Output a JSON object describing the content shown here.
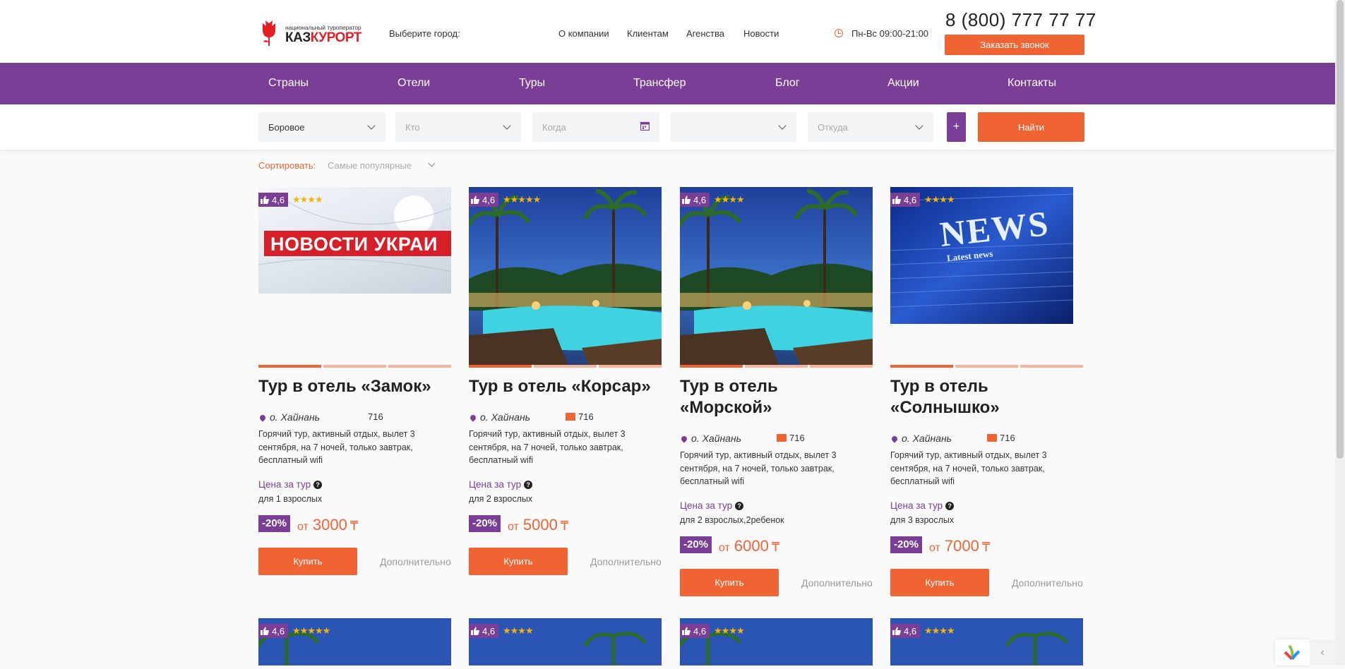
{
  "header": {
    "logo": {
      "subtitle": "национальный туроператор",
      "brand_part1": "КАЗ",
      "brand_part2": "КУРОРТ"
    },
    "city_label": "Выберите город:",
    "nav": [
      "О компании",
      "Клиентам",
      "Агенства",
      "Новости"
    ],
    "hours": "Пн-Вс 09:00-21:00",
    "phone": "8 (800) 777 77 77",
    "callback_button": "Заказать звонок"
  },
  "main_nav": [
    "Страны",
    "Отели",
    "Туры",
    "Трансфер",
    "Блог",
    "Акции",
    "Контакты"
  ],
  "search": {
    "destination": "Боровое",
    "who_placeholder": "Кто",
    "when_placeholder": "Когда",
    "empty_select": "",
    "from_placeholder": "Откуда",
    "plus_button": "+",
    "find_button": "Найти"
  },
  "sort": {
    "label": "Сортировать:",
    "value": "Самые популярные"
  },
  "cards": [
    {
      "rating": "4,6",
      "stars": "★★★★",
      "title": "Тур в отель «Замок»",
      "location": "о. Хайнань",
      "reviews": "716",
      "description": "Горячий тур, активный отдых, вылет 3 сентября, на 7 ночей, только завтрак, бесплатный wifi",
      "price_label": "Цена за тур",
      "guests": "для 1 взрослых",
      "discount": "-20%",
      "price_from": "от",
      "price": "3000",
      "currency": "₸",
      "buy": "Купить",
      "more": "Дополнительно",
      "image": "news-ukraine",
      "image_text": "НОВОСТИ УКРАИ"
    },
    {
      "rating": "4,6",
      "stars": "★★★★★",
      "title": "Тур в отель «Корсар»",
      "location": "о. Хайнань",
      "reviews": "716",
      "description": "Горячий тур, активный отдых, вылет 3 сентября, на 7 ночей, только завтрак, бесплатный wifi",
      "price_label": "Цена за тур",
      "guests": "для 2 взрослых",
      "discount": "-20%",
      "price_from": "от",
      "price": "5000",
      "currency": "₸",
      "buy": "Купить",
      "more": "Дополнительно",
      "image": "resort-pool"
    },
    {
      "rating": "4,6",
      "stars": "★★★★",
      "title": "Тур в отель «Морской»",
      "location": "о. Хайнань",
      "reviews": "716",
      "description": "Горячий тур, активный отдых, вылет 3 сентября, на 7 ночей, только завтрак, бесплатный wifi",
      "price_label": "Цена за тур",
      "guests": "для 2 взрослых,2ребенок",
      "discount": "-20%",
      "price_from": "от",
      "price": "6000",
      "currency": "₸",
      "buy": "Купить",
      "more": "Дополнительно",
      "image": "resort-pool"
    },
    {
      "rating": "4,6",
      "stars": "★★★★",
      "title": "Тур в отель «Солнышко»",
      "location": "о. Хайнань",
      "reviews": "716",
      "description": "Горячий тур, активный отдых, вылет 3 сентября, на 7 ночей, только завтрак, бесплатный wifi",
      "price_label": "Цена за тур",
      "guests": "для 3 взрослых",
      "discount": "-20%",
      "price_from": "от",
      "price": "7000",
      "currency": "₸",
      "buy": "Купить",
      "more": "Дополнительно",
      "image": "news-blue",
      "image_text": "NEWS",
      "image_subtext": "Latest news"
    }
  ],
  "second_row": [
    {
      "rating": "4,6",
      "stars": "★★★★★"
    },
    {
      "rating": "4,6",
      "stars": "★★★★"
    },
    {
      "rating": "4,6",
      "stars": "★★★★"
    },
    {
      "rating": "4,6",
      "stars": "★★★★"
    }
  ],
  "colors": {
    "accent": "#f06434",
    "purple": "#7b3e96",
    "star": "#f5b400"
  }
}
